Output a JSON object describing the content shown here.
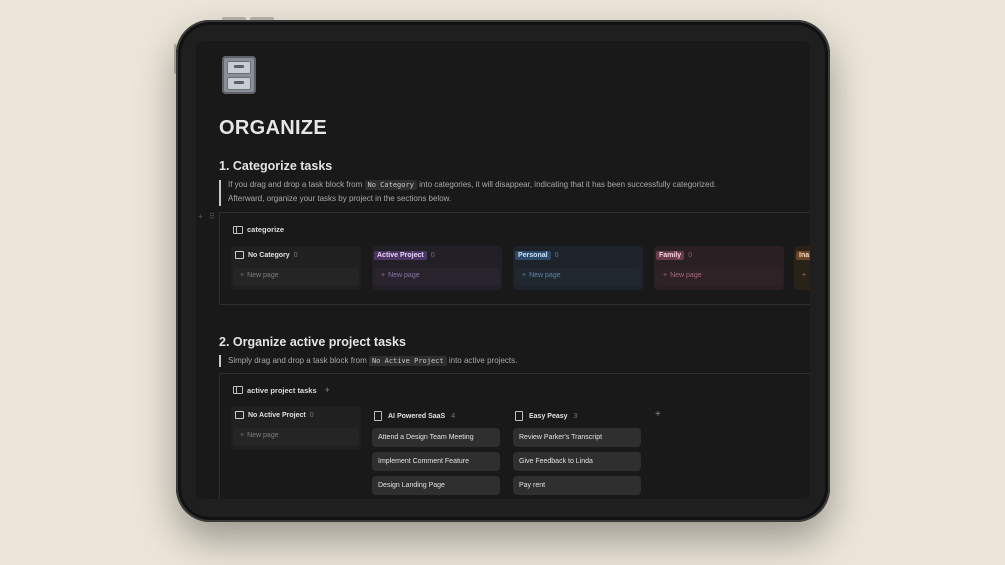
{
  "page": {
    "title": "ORGANIZE"
  },
  "section1": {
    "heading": "1. Categorize tasks",
    "text_part1": "If you drag and drop a task block from",
    "code": "No Category",
    "text_part2": "into categories, it will disappear, indicating that it has been successfully categorized.",
    "text_line2": "Afterward, organize your tasks by project in the sections below.",
    "database_title": "categorize",
    "columns": [
      {
        "label": "No Category",
        "count": "0",
        "new_page": "New page",
        "color": "#d8d8d8"
      },
      {
        "label": "Active Project",
        "count": "0",
        "new_page": "New page",
        "color": "#b48fd6"
      },
      {
        "label": "Personal",
        "count": "0",
        "new_page": "New page",
        "color": "#6f9ed1"
      },
      {
        "label": "Family",
        "count": "0",
        "new_page": "New page",
        "color": "#d1829b"
      },
      {
        "label": "Ina",
        "count": "",
        "new_page": "",
        "color": "#d49a6a"
      }
    ]
  },
  "section2": {
    "heading": "2. Organize active project tasks",
    "text_part1": "Simply drag and drop a task block from",
    "code": "No Active Project",
    "text_part2": "into active projects.",
    "database_title": "active project tasks",
    "add_symbol": "+",
    "columns": [
      {
        "label": "No Active Project",
        "count": "0",
        "new_page": "New page",
        "cards": []
      },
      {
        "label": "AI Powered SaaS",
        "count": "4",
        "cards": [
          "Attend a Design Team Meeting",
          "Implement Comment Feature",
          "Design Landing Page"
        ]
      },
      {
        "label": "Easy Peasy",
        "count": "3",
        "cards": [
          "Review Parker's Transcript",
          "Give Feedback to Linda",
          "Pay rent"
        ]
      }
    ]
  },
  "colors": {
    "background": "#ece6d9",
    "screen": "#191919",
    "text": "#e6e6e6"
  }
}
